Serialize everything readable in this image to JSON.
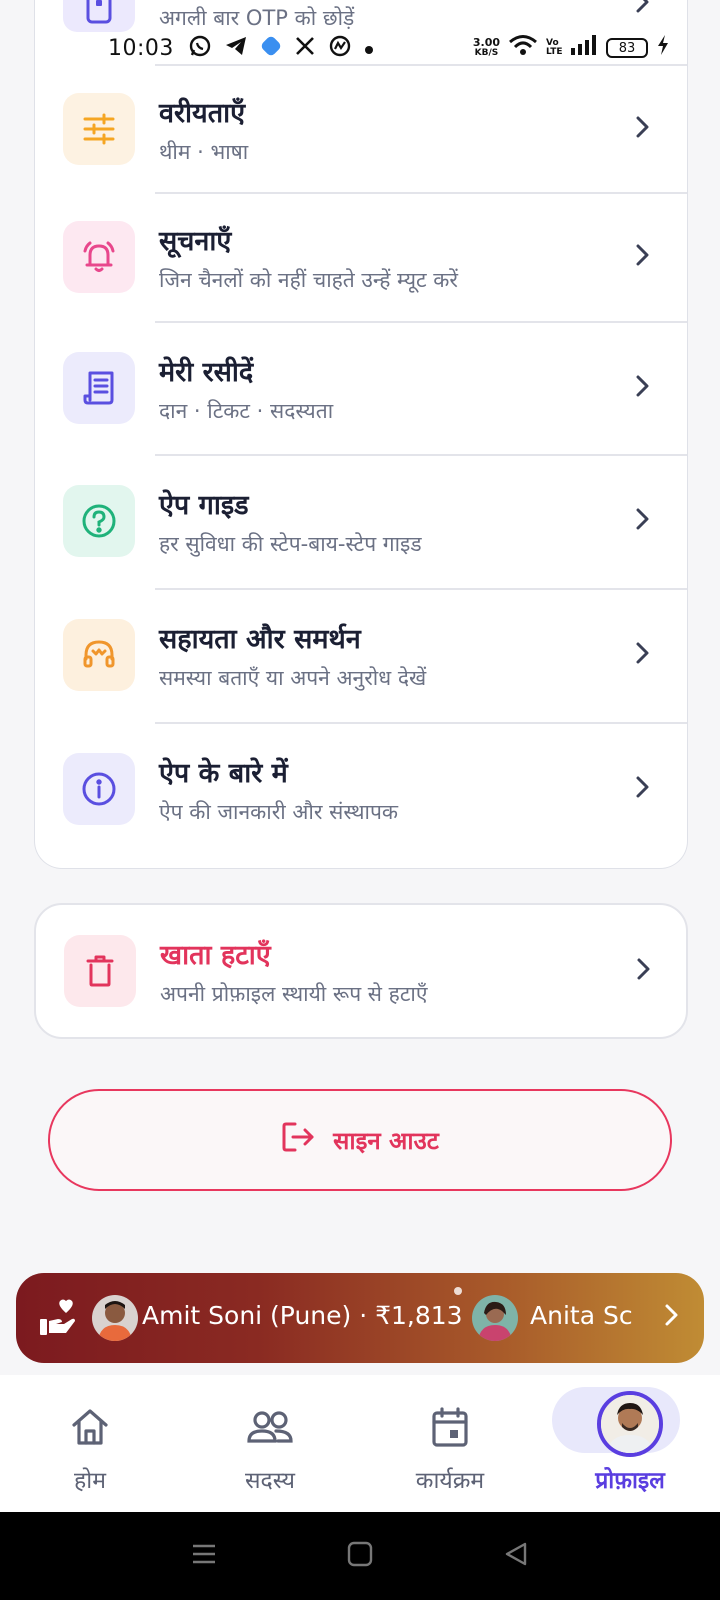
{
  "top_partial": {
    "subtitle": "अगली बार OTP को छोड़ें"
  },
  "status_bar": {
    "time": "10:03",
    "net_speed_value": "3.00",
    "net_speed_unit": "KB/S",
    "volte": "Vo LTE",
    "battery": "83"
  },
  "settings": {
    "items": [
      {
        "title": "वरीयताएँ",
        "subtitle": "थीम · भाषा",
        "icon": "sliders-icon",
        "color": "#f5a623",
        "bg": "#fdf2e2"
      },
      {
        "title": "सूचनाएँ",
        "subtitle": "जिन चैनलों को नहीं चाहते उन्हें म्यूट करें",
        "icon": "bell-icon",
        "color": "#e8478c",
        "bg": "#fde8f1"
      },
      {
        "title": "मेरी रसीदें",
        "subtitle": "दान · टिकट · सदस्यता",
        "icon": "receipt-icon",
        "color": "#5a4fe0",
        "bg": "#ecebfc"
      },
      {
        "title": "ऐप गाइड",
        "subtitle": "हर सुविधा की स्टेप-बाय-स्टेप गाइड",
        "icon": "help-circle-icon",
        "color": "#1fb27a",
        "bg": "#e2f6ee"
      },
      {
        "title": "सहायता और समर्थन",
        "subtitle": "समस्या बताएँ या अपने अनुरोध देखें",
        "icon": "headset-icon",
        "color": "#f0962c",
        "bg": "#fdf0de"
      },
      {
        "title": "ऐप के बारे में",
        "subtitle": "ऐप की जानकारी और संस्थापक",
        "icon": "info-icon",
        "color": "#5a4fe0",
        "bg": "#ecebfc"
      }
    ]
  },
  "delete_account": {
    "title": "खाता हटाएँ",
    "subtitle": "अपनी प्रोफ़ाइल स्थायी रूप से हटाएँ",
    "icon": "trash-icon",
    "color": "#e2345c",
    "bg": "#fde8ec"
  },
  "signout": {
    "label": "साइन आउट"
  },
  "ticker": {
    "entries": [
      {
        "text": "Amit Soni (Pune) · ₹1,813"
      },
      {
        "text": "Anita Sc"
      }
    ]
  },
  "bottom_nav": {
    "items": [
      {
        "label": "होम",
        "icon": "home-icon"
      },
      {
        "label": "सदस्य",
        "icon": "members-icon"
      },
      {
        "label": "कार्यक्रम",
        "icon": "calendar-icon"
      },
      {
        "label": "प्रोफ़ाइल",
        "icon": "profile-avatar"
      }
    ],
    "active_index": 3
  }
}
